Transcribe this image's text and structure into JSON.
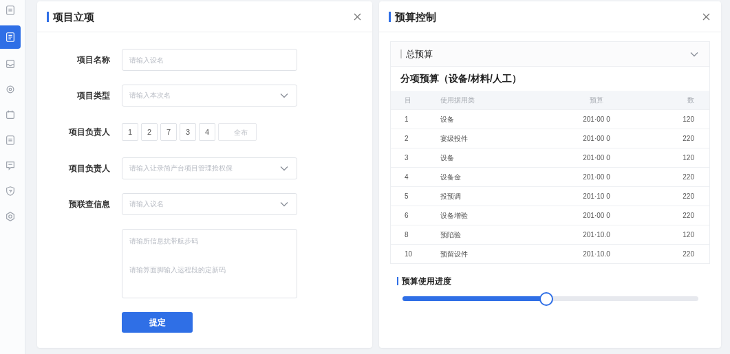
{
  "sidebar": {
    "items": [
      {
        "selected": false
      },
      {
        "selected": true
      },
      {
        "selected": false
      },
      {
        "selected": false
      },
      {
        "selected": false
      },
      {
        "selected": false
      },
      {
        "selected": false
      },
      {
        "selected": false
      },
      {
        "selected": false
      }
    ]
  },
  "project_panel": {
    "title": "项目立项",
    "fields": [
      {
        "kind": "input",
        "label": "项目名称",
        "placeholder": "请输入设名"
      },
      {
        "kind": "select",
        "label": "项目类型",
        "placeholder": "请输入本次名"
      },
      {
        "kind": "chips",
        "label": "项目负责人",
        "chips": [
          "1",
          "2",
          "7",
          "3",
          "4"
        ],
        "extra_placeholder": "全布"
      },
      {
        "kind": "select",
        "label": "项目负责人",
        "placeholder": "请输入让录简产台项目管理抢权保"
      },
      {
        "kind": "select",
        "label": "预联查信息",
        "placeholder": "请输入议名"
      },
      {
        "kind": "textarea",
        "placeholder_lines": [
          "请输所信息抗带航步码",
          "请输算面脚输入运程段的定新码"
        ]
      }
    ],
    "submit": "提定"
  },
  "budget_panel": {
    "title": "预算控制",
    "section": "总预算",
    "subtitle": "分项预算（设备/材料/人工）",
    "table": {
      "columns": [
        "目",
        "使用据用类",
        "预算",
        "数"
      ],
      "rows": [
        [
          "1",
          "设备",
          "201·00 0",
          "120"
        ],
        [
          "2",
          "宴级投件",
          "201·00 0",
          "220"
        ],
        [
          "3",
          "设备",
          "201·00 0",
          "120"
        ],
        [
          "4",
          "设备金",
          "201·00 0",
          "220"
        ],
        [
          "5",
          "投预调",
          "201·10 0",
          "220"
        ],
        [
          "6",
          "设备增验",
          "201·00 0",
          "220"
        ],
        [
          "8",
          "预陷验",
          "201·10.0",
          "120"
        ],
        [
          "10",
          "预留设件",
          "201·10.0",
          "220"
        ]
      ]
    },
    "progress": {
      "title": "预算使用进度",
      "level": 0.485
    }
  }
}
